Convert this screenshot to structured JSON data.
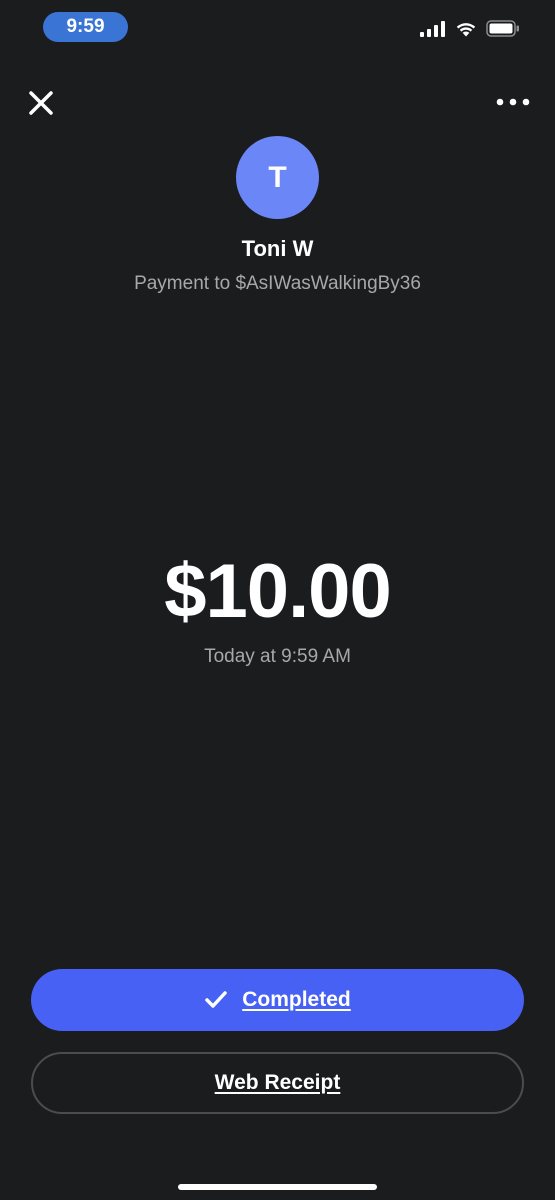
{
  "status_bar": {
    "time": "9:59",
    "time_pill_color": "#3a75d6",
    "icons": [
      "cellular-signal-icon",
      "wifi-icon",
      "battery-icon"
    ]
  },
  "header": {
    "close_icon": "close-icon",
    "more_icon": "more-options-icon"
  },
  "recipient": {
    "avatar_initial": "T",
    "avatar_color": "#6b86f7",
    "name": "Toni W",
    "payment_to": "Payment to $AsIWasWalkingBy36"
  },
  "payment": {
    "amount": "$10.00",
    "timestamp": "Today at 9:59 AM"
  },
  "actions": {
    "completed_label": "Completed",
    "completed_color": "#4661f3",
    "web_receipt_label": "Web Receipt"
  }
}
